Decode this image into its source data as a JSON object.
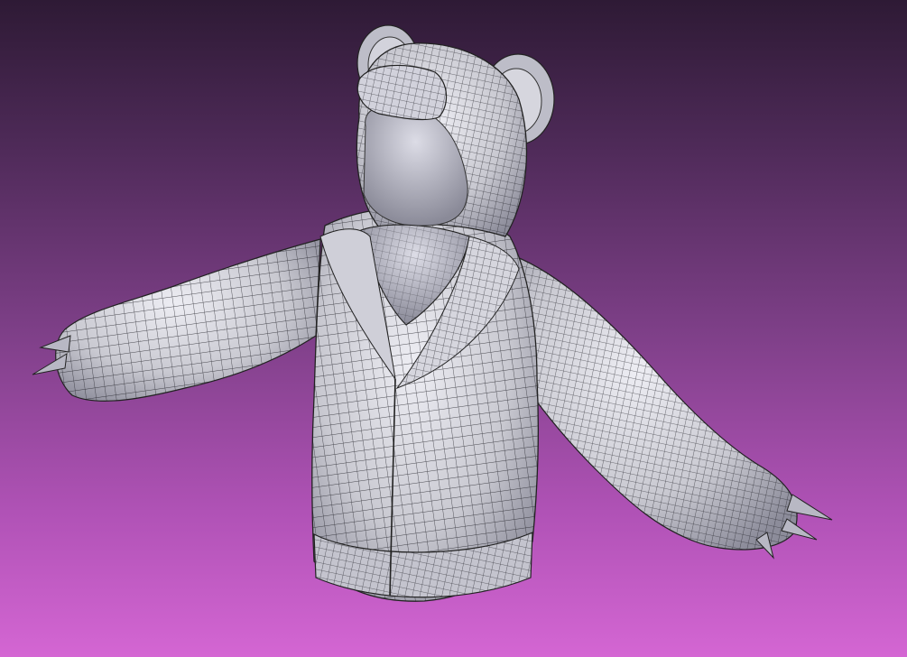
{
  "scene": {
    "subject_icon": "bear-hoodie-wireframe-icon",
    "colors": {
      "background_top": "#2e1a35",
      "background_bottom": "#d466d3",
      "mesh_fill": "#c9c9d1",
      "mesh_shadow": "#8c8c9a",
      "mesh_highlight": "#eeeef4",
      "wire": "#1c1c22",
      "interior": "#a4a4b2"
    }
  }
}
